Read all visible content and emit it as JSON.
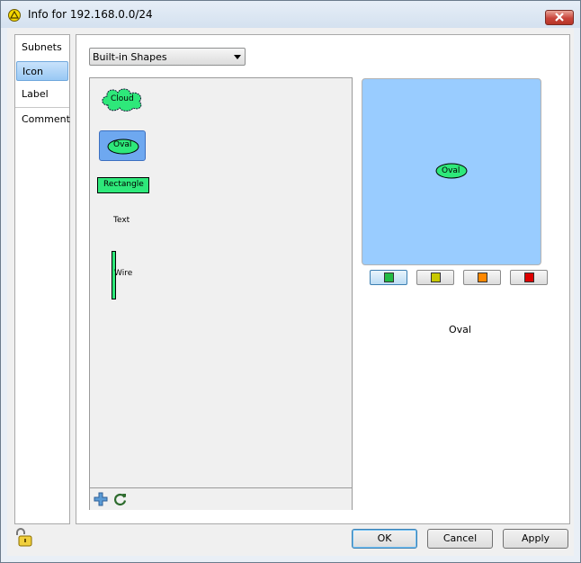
{
  "window": {
    "title": "Info for 192.168.0.0/24"
  },
  "nav": {
    "items": [
      {
        "label": "Subnets"
      },
      {
        "label": "Icon",
        "selected": true
      },
      {
        "label": "Label"
      },
      {
        "label": "Comment"
      }
    ]
  },
  "shape_source": {
    "selected": "Built-in Shapes"
  },
  "shapes": [
    {
      "label": "Cloud",
      "shape": "cloud"
    },
    {
      "label": "Oval",
      "shape": "oval",
      "selected": true
    },
    {
      "label": "Rectangle",
      "shape": "rectangle"
    },
    {
      "label": "Text",
      "shape": "text"
    },
    {
      "label": "Wire",
      "shape": "wire"
    }
  ],
  "preview": {
    "shape_label": "Oval",
    "background": "#99ccff"
  },
  "colors": [
    {
      "name": "green",
      "hex": "#22bb44",
      "active": true
    },
    {
      "name": "yellow",
      "hex": "#c8c800"
    },
    {
      "name": "orange",
      "hex": "#ff8800"
    },
    {
      "name": "red",
      "hex": "#dd0000"
    }
  ],
  "selected_shape_name": "Oval",
  "buttons": {
    "ok": "OK",
    "cancel": "Cancel",
    "apply": "Apply"
  },
  "icons": {
    "title": "warning-triangle-icon",
    "lock": "lock-icon",
    "add": "add-icon",
    "refresh": "refresh-icon",
    "close": "close-icon"
  }
}
